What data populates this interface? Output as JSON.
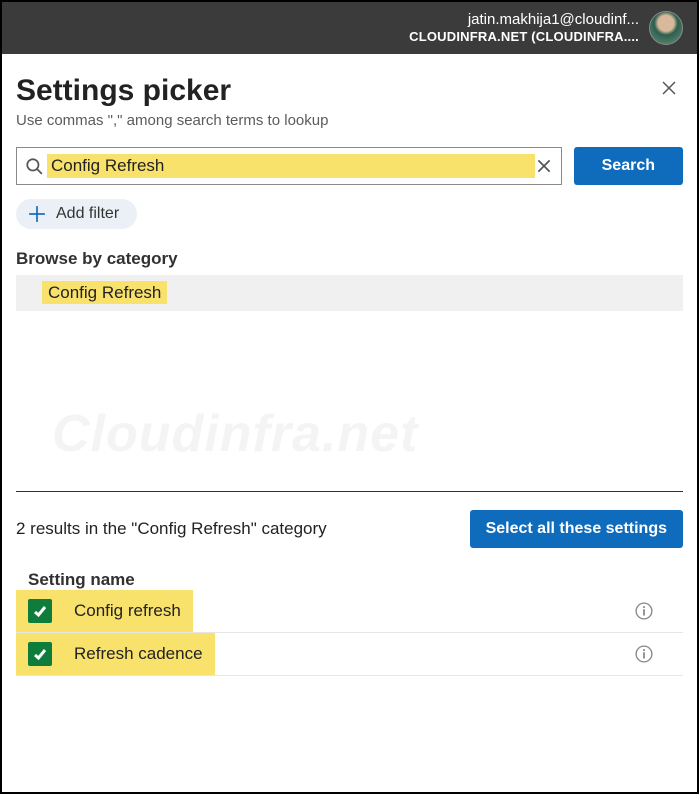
{
  "topbar": {
    "email": "jatin.makhija1@cloudinf...",
    "org": "CLOUDINFRA.NET (CLOUDINFRA...."
  },
  "header": {
    "title": "Settings picker",
    "subtitle": "Use commas \",\" among search terms to lookup"
  },
  "search": {
    "value": "Config Refresh",
    "button_label": "Search"
  },
  "filter": {
    "add_label": "Add filter"
  },
  "browse": {
    "label": "Browse by category",
    "category": "Config Refresh"
  },
  "watermark": "Cloudinfra.net",
  "results": {
    "summary": "2 results in the \"Config Refresh\" category",
    "select_all_label": "Select all these settings",
    "column_header": "Setting name",
    "items": [
      {
        "name": "Config refresh",
        "checked": true
      },
      {
        "name": "Refresh cadence",
        "checked": true
      }
    ]
  }
}
